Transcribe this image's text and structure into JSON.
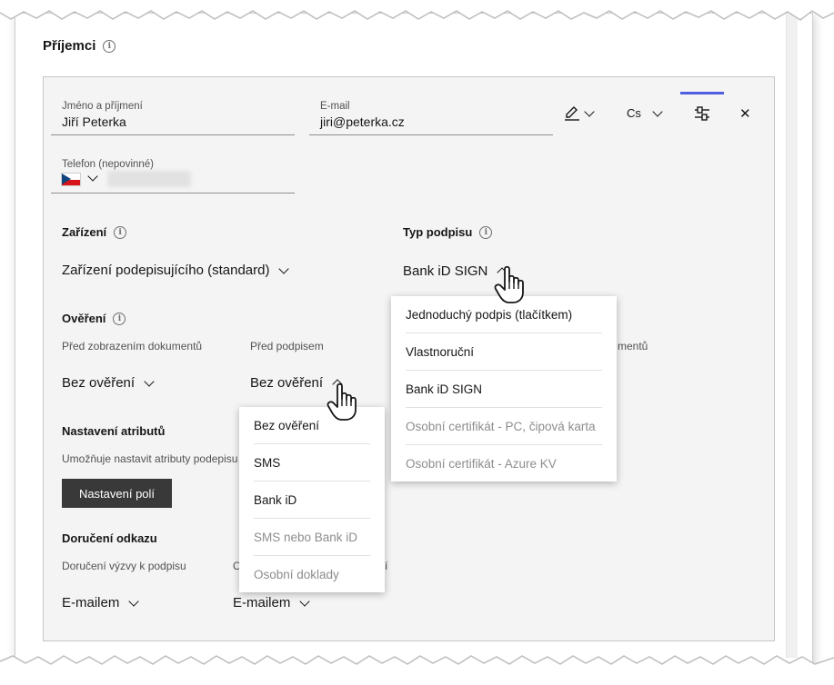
{
  "section": {
    "title": "Příjemci"
  },
  "recipient": {
    "name_label": "Jméno a příjmení",
    "name_value": "Jiří Peterka",
    "email_label": "E-mail",
    "email_value": "jiri@peterka.cz",
    "phone_label": "Telefon (nepovinné)",
    "language_code": "Cs"
  },
  "device": {
    "heading": "Zařízení",
    "selected": "Zařízení podepisujícího (standard)"
  },
  "signature_type": {
    "heading": "Typ podpisu",
    "selected": "Bank iD SIGN",
    "options": [
      {
        "label": "Jednoduchý podpis (tlačítkem)",
        "disabled": false
      },
      {
        "label": "Vlastnoruční",
        "disabled": false
      },
      {
        "label": "Bank iD SIGN",
        "disabled": false
      },
      {
        "label": "Osobní certifikát - PC, čipová karta",
        "disabled": true
      },
      {
        "label": "Osobní certifikát - Azure KV",
        "disabled": true
      }
    ]
  },
  "verification": {
    "heading": "Ověření",
    "before_view_label": "Před zobrazením dokumentů",
    "before_view_value": "Bez ověření",
    "before_sign_label": "Před podpisem",
    "before_sign_value": "Bez ověření",
    "third_label_fragment": "mentů",
    "options": [
      {
        "label": "Bez ověření",
        "disabled": false
      },
      {
        "label": "SMS",
        "disabled": false
      },
      {
        "label": "Bank iD",
        "disabled": false
      },
      {
        "label": "SMS nebo Bank iD",
        "disabled": true
      },
      {
        "label": "Osobní doklady",
        "disabled": true
      }
    ]
  },
  "attributes": {
    "heading": "Nastavení atributů",
    "description_fragment": "Umožňuje nastavit atributy podepisu",
    "button_label": "Nastavení polí"
  },
  "delivery": {
    "heading": "Doručení odkazu",
    "invite_label": "Doručení výzvy k podpisu",
    "invite_value": "E-mailem",
    "second_label_fragment_left": "O",
    "second_label_fragment_right": "í",
    "second_value": "E-mailem"
  },
  "icons": {
    "info": "info-icon",
    "edit": "pencil-icon",
    "settings": "sliders-icon",
    "close": "close-icon",
    "cursor": "hand-pointer-icon"
  },
  "colors": {
    "accent": "#4f5fe0",
    "button_dark": "#393939"
  }
}
